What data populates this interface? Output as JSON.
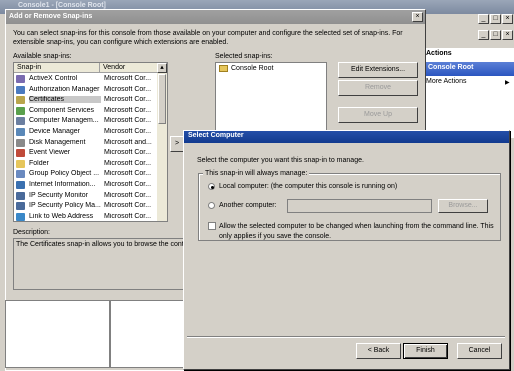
{
  "mmc": {
    "title": "Console1 - [Console Root]",
    "actions_header": "Actions",
    "actions_root": "Console Root",
    "actions_more": "More Actions"
  },
  "snapin_dialog": {
    "title": "Add or Remove Snap-ins",
    "description": "You can select snap-ins for this console from those available on your computer and configure the selected set of snap-ins. For extensible snap-ins, you can configure which extensions are enabled.",
    "available_label": "Available snap-ins:",
    "selected_label": "Selected snap-ins:",
    "col_snapin": "Snap-in",
    "col_vendor": "Vendor",
    "snapins": [
      {
        "name": "ActiveX Control",
        "vendor": "Microsoft Cor...",
        "color": "#7a6bb0"
      },
      {
        "name": "Authorization Manager",
        "vendor": "Microsoft Cor...",
        "color": "#4a7ac0"
      },
      {
        "name": "Certificates",
        "vendor": "Microsoft Cor...",
        "color": "#b9a54c"
      },
      {
        "name": "Component Services",
        "vendor": "Microsoft Cor...",
        "color": "#5aa04c"
      },
      {
        "name": "Computer Managem...",
        "vendor": "Microsoft Cor...",
        "color": "#6b7fa0"
      },
      {
        "name": "Device Manager",
        "vendor": "Microsoft Cor...",
        "color": "#5a88b8"
      },
      {
        "name": "Disk Management",
        "vendor": "Microsoft and...",
        "color": "#8a8a8a"
      },
      {
        "name": "Event Viewer",
        "vendor": "Microsoft Cor...",
        "color": "#c04a3a"
      },
      {
        "name": "Folder",
        "vendor": "Microsoft Cor...",
        "color": "#e6c65b"
      },
      {
        "name": "Group Policy Object ...",
        "vendor": "Microsoft Cor...",
        "color": "#6a8ac0"
      },
      {
        "name": "Internet Information...",
        "vendor": "Microsoft Cor...",
        "color": "#3a70b0"
      },
      {
        "name": "IP Security Monitor",
        "vendor": "Microsoft Cor...",
        "color": "#4a6a9a"
      },
      {
        "name": "IP Security Policy Ma...",
        "vendor": "Microsoft Cor...",
        "color": "#4a6a9a"
      },
      {
        "name": "Link to Web Address",
        "vendor": "Microsoft Cor...",
        "color": "#3a88c8"
      }
    ],
    "selected_item": "Console Root",
    "btn_edit_extensions": "Edit Extensions...",
    "btn_remove": "Remove",
    "btn_move_up": "Move Up",
    "btn_add": ">",
    "description_label": "Description:",
    "description_text": "The Certificates snap-in allows you to browse the conte"
  },
  "select_computer": {
    "title": "Select Computer",
    "instruction": "Select the computer you want this snap-in to manage.",
    "group_label": "This snap-in will always manage:",
    "local_label": "Local computer:  (the computer this console is running on)",
    "another_label": "Another computer:",
    "another_value": "",
    "browse": "Browse...",
    "allow_label": "Allow the selected computer to be changed when launching from the command line.  This only applies if you save the console.",
    "back": "< Back",
    "finish": "Finish",
    "cancel": "Cancel"
  }
}
